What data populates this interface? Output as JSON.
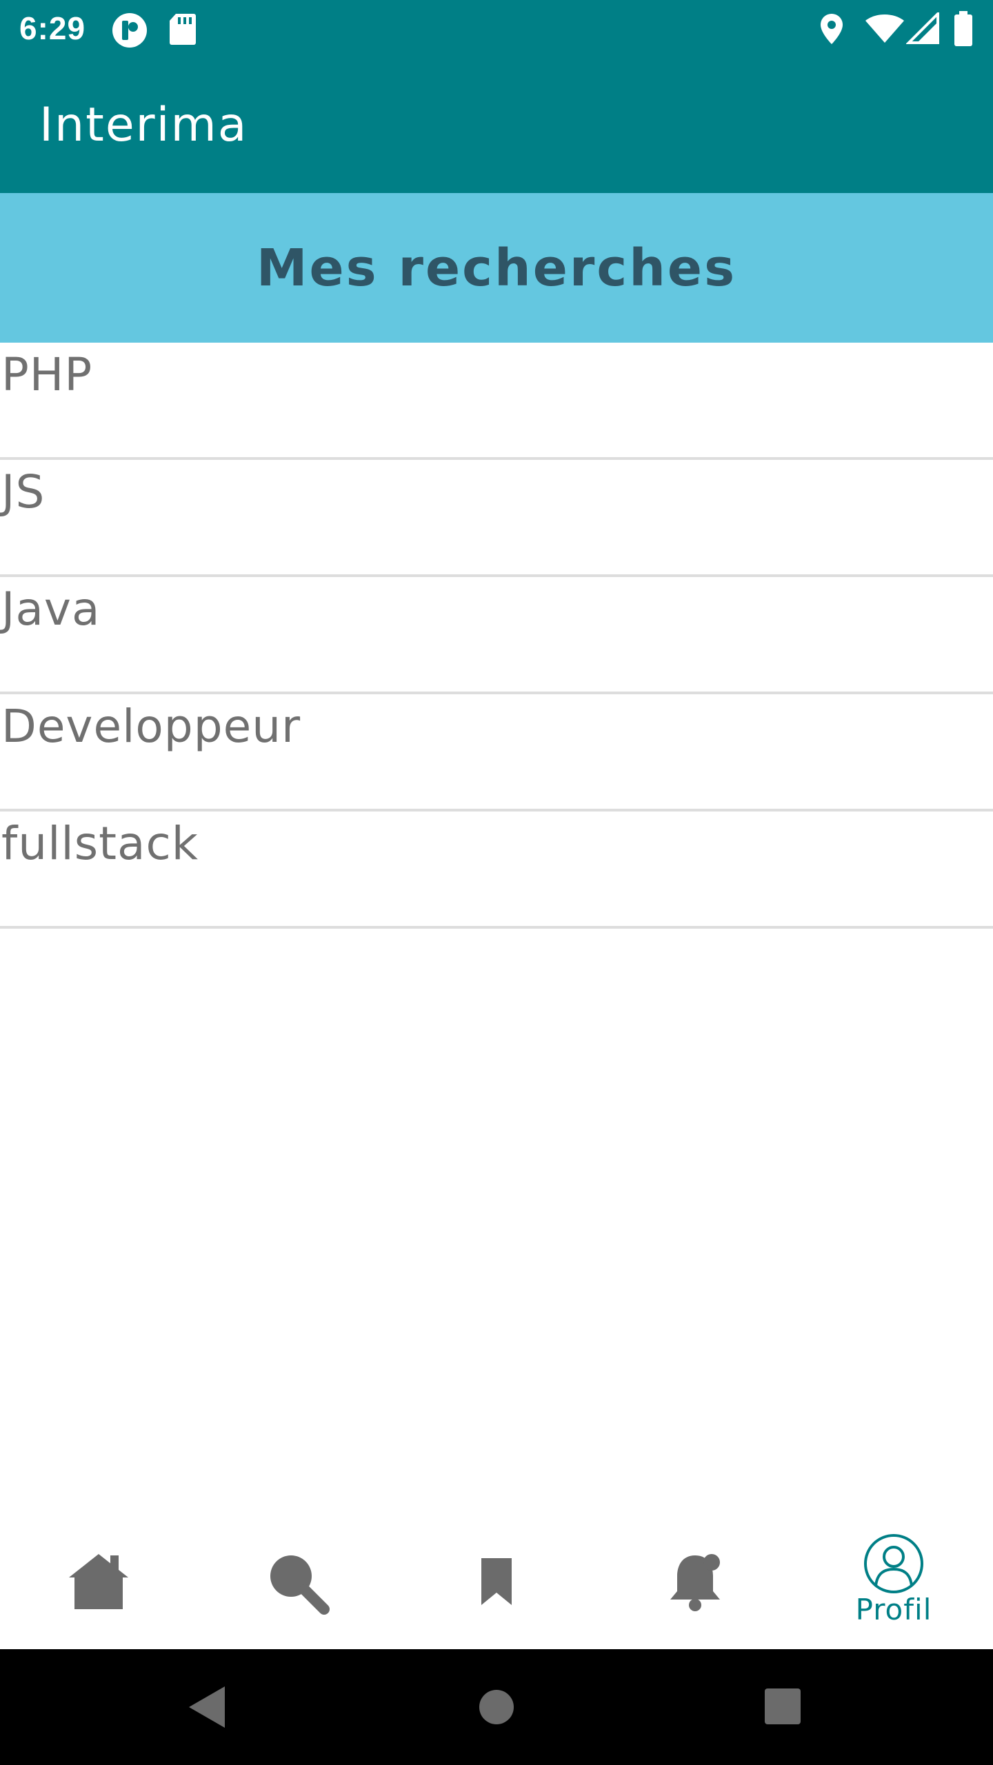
{
  "status_bar": {
    "time": "6:29",
    "icons": [
      "notification-app-icon",
      "sd-card-icon",
      "location-icon",
      "wifi-icon",
      "cell-signal-icon",
      "battery-icon"
    ]
  },
  "app_bar": {
    "title": "Interima"
  },
  "header": {
    "title": "Mes recherches"
  },
  "searches": [
    "PHP",
    "JS",
    "Java",
    "Developpeur",
    "fullstack"
  ],
  "bottom_nav": {
    "items": [
      {
        "icon": "home-icon",
        "label": ""
      },
      {
        "icon": "search-icon",
        "label": ""
      },
      {
        "icon": "bookmark-icon",
        "label": ""
      },
      {
        "icon": "bell-icon",
        "label": ""
      },
      {
        "icon": "profile-icon",
        "label": "Profil",
        "active": true
      }
    ]
  },
  "system_nav": [
    "back-icon",
    "home-circle-icon",
    "recents-icon"
  ],
  "colors": {
    "primary": "#007f86",
    "header_band": "#64c7e0",
    "header_text": "#2f5566",
    "list_text": "#707070",
    "divider": "#dddddd",
    "nav_inactive": "#6b6b6b"
  }
}
